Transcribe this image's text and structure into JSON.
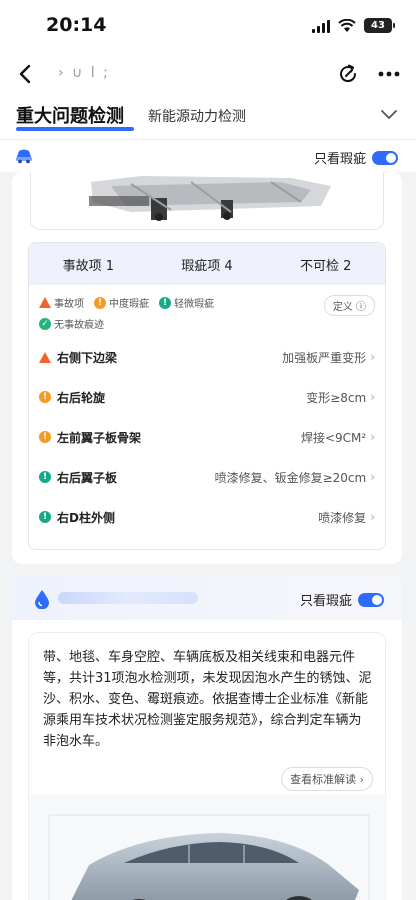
{
  "status": {
    "time": "20:14",
    "battery": "43"
  },
  "nav": {
    "title": "› ∪ l ;"
  },
  "tabs": {
    "active": "重大问题检测",
    "other": "新能源动力检测"
  },
  "filter": {
    "toggle_label": "只看瑕疵"
  },
  "summary": {
    "accident": "事故项 1",
    "flaw": "瑕疵项 4",
    "uncheckable": "不可检 2"
  },
  "legend": {
    "accident": "事故项",
    "moderate": "中度瑕疵",
    "light": "轻微瑕疵",
    "none": "无事故痕迹",
    "definition": "定义 ⓘ"
  },
  "issues": [
    {
      "name": "右侧下边梁",
      "value": "加强板严重变形",
      "level": "accident"
    },
    {
      "name": "右后轮旋",
      "value": "变形≥8cm",
      "level": "moderate"
    },
    {
      "name": "左前翼子板骨架",
      "value": "焊接<9CM²",
      "level": "moderate"
    },
    {
      "name": "右后翼子板",
      "value": "喷漆修复、钣金修复≥20cm",
      "level": "light"
    },
    {
      "name": "右D柱外侧",
      "value": "喷漆修复",
      "level": "light"
    }
  ],
  "card2": {
    "toggle_label": "只看瑕疵",
    "paragraph": "带、地毯、车身空腔、车辆底板及相关线束和电器元件等，共计31项泡水检测项，未发现因泡水产生的锈蚀、泥沙、积水、变色、霉斑痕迹。依据查博士企业标准《新能源乘用车技术状况检测鉴定服务规范》，综合判定车辆为非泡水车。",
    "std_button": "查看标准解读 ›"
  },
  "colors": {
    "accent": "#2f6bff",
    "accident": "#f0642a",
    "moderate": "#f59a23",
    "light": "#18a98b"
  }
}
